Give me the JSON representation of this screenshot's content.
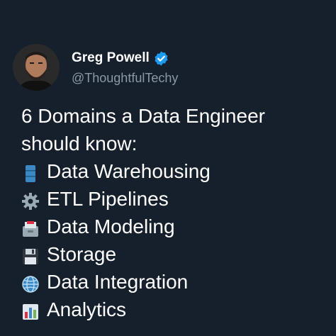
{
  "author": {
    "display_name": "Greg Powell",
    "handle": "@ThoughtfulTechy",
    "verified": true,
    "verified_color": "#1d9bf0"
  },
  "tweet": {
    "intro_line1": "6 Domains a Data Engineer",
    "intro_line2": "should know:",
    "domains": [
      {
        "icon": "database-stack-icon",
        "label": "Data Warehousing"
      },
      {
        "icon": "gear-icon",
        "label": "ETL Pipelines"
      },
      {
        "icon": "file-cabinet-icon",
        "label": "Data Modeling"
      },
      {
        "icon": "floppy-disk-icon",
        "label": "Storage"
      },
      {
        "icon": "globe-icon",
        "label": "Data Integration"
      },
      {
        "icon": "bar-chart-icon",
        "label": "Analytics"
      }
    ]
  },
  "colors": {
    "background": "#16202c",
    "text": "#ffffff",
    "handle": "#8b98a5"
  }
}
